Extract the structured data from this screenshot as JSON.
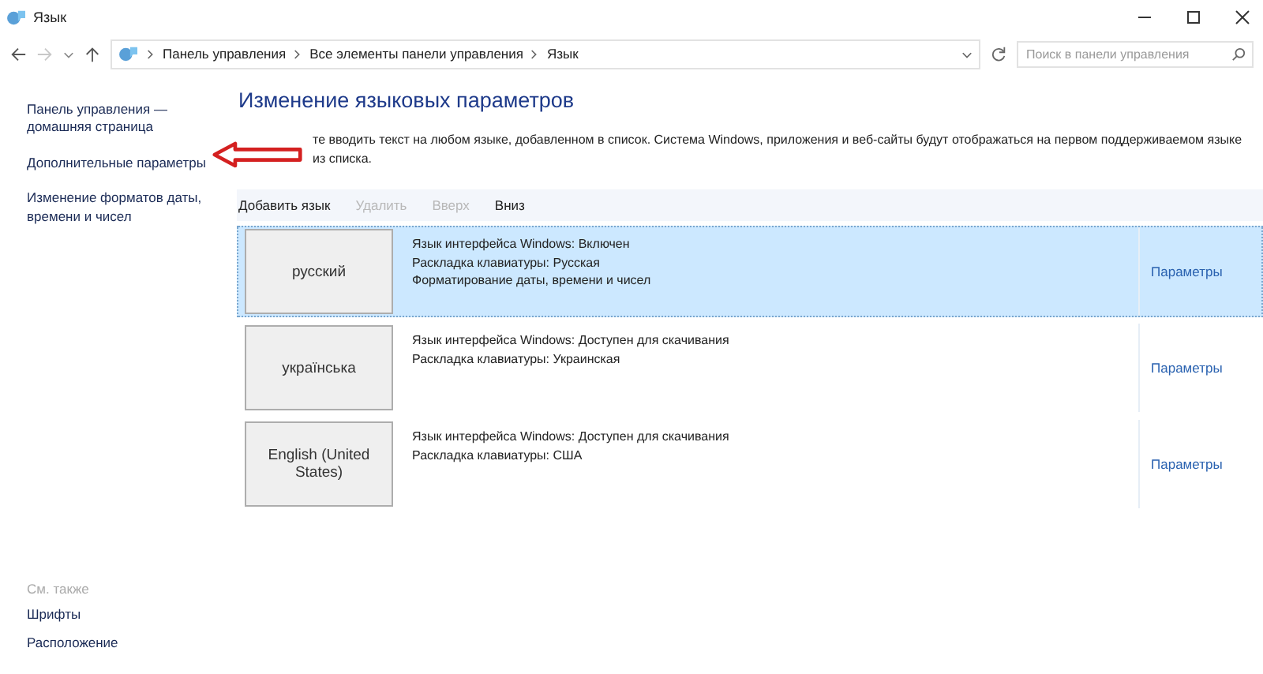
{
  "window": {
    "title": "Язык"
  },
  "address_bar": {
    "breadcrumbs": [
      "Панель управления",
      "Все элементы панели управления",
      "Язык"
    ],
    "forward_disabled": true
  },
  "search": {
    "placeholder": "Поиск в панели управления"
  },
  "sidebar": {
    "links": [
      "Панель управления — домашняя страница",
      "Дополнительные параметры",
      "Изменение форматов даты, времени и чисел"
    ],
    "see_also": {
      "title": "См. также",
      "links": [
        "Шрифты",
        "Расположение"
      ]
    }
  },
  "content": {
    "heading": "Изменение языковых параметров",
    "description": "те вводить текст на любом языке, добавленном в список. Система Windows, приложения и веб-сайты будут отображаться на первом поддерживаемом языке из списка.",
    "toolbar": [
      {
        "label": "Добавить язык",
        "disabled": false
      },
      {
        "label": "Удалить",
        "disabled": true
      },
      {
        "label": "Вверх",
        "disabled": true
      },
      {
        "label": "Вниз",
        "disabled": false
      }
    ],
    "languages": [
      {
        "name": "русский",
        "selected": true,
        "details": [
          "Язык интерфейса Windows: Включен",
          "Раскладка клавиатуры: Русская",
          "Форматирование даты, времени и чисел"
        ],
        "options_link": "Параметры"
      },
      {
        "name": "українська",
        "selected": false,
        "details": [
          "Язык интерфейса Windows: Доступен для скачивания",
          "Раскладка клавиатуры: Украинская"
        ],
        "options_link": "Параметры"
      },
      {
        "name": "English (United States)",
        "selected": false,
        "details": [
          "Язык интерфейса Windows: Доступен для скачивания",
          "Раскладка клавиатуры: США"
        ],
        "options_link": "Параметры"
      }
    ]
  }
}
